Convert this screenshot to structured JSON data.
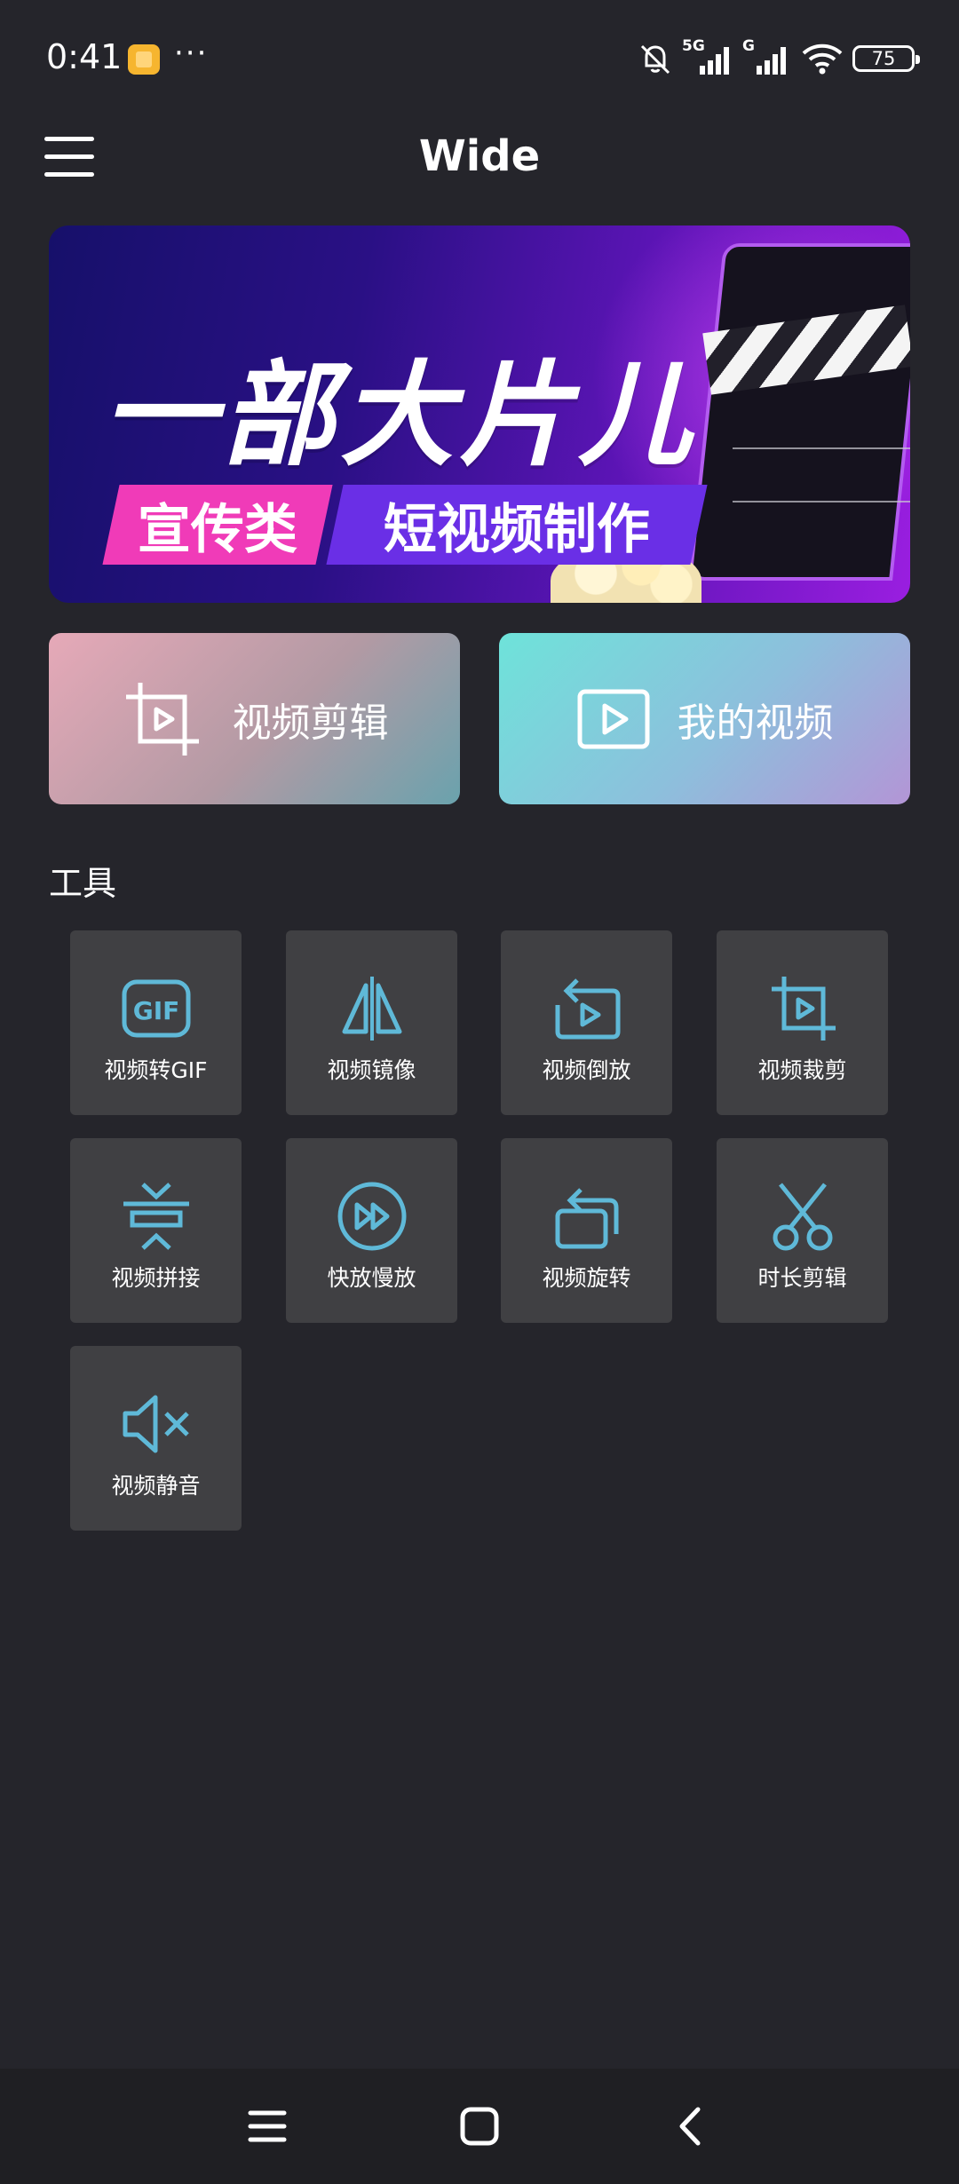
{
  "status_bar": {
    "time": "0:41",
    "more": "···",
    "network_1": "5G",
    "network_2": "G",
    "battery": "75"
  },
  "app_bar": {
    "title": "Wide",
    "menu_icon": "hamburger-menu-icon"
  },
  "banner": {
    "title": "一部大片儿",
    "tag_left": "宣传类",
    "tag_right": "短视频制作"
  },
  "quick_actions": [
    {
      "label": "视频剪辑",
      "icon": "crop-play-icon"
    },
    {
      "label": "我的视频",
      "icon": "play-box-icon"
    }
  ],
  "tools_section": {
    "title": "工具",
    "accent_color": "#5fb9d8",
    "items": [
      {
        "label": "视频转GIF",
        "icon": "gif-icon"
      },
      {
        "label": "视频镜像",
        "icon": "mirror-icon"
      },
      {
        "label": "视频倒放",
        "icon": "reverse-play-icon"
      },
      {
        "label": "视频裁剪",
        "icon": "crop-icon"
      },
      {
        "label": "视频拼接",
        "icon": "merge-icon"
      },
      {
        "label": "快放慢放",
        "icon": "fast-forward-icon"
      },
      {
        "label": "视频旋转",
        "icon": "rotate-icon"
      },
      {
        "label": "时长剪辑",
        "icon": "scissors-icon"
      },
      {
        "label": "视频静音",
        "icon": "mute-icon"
      }
    ]
  },
  "nav_bar": {
    "recents_icon": "recents-icon",
    "home_icon": "home-icon",
    "back_icon": "back-icon"
  }
}
